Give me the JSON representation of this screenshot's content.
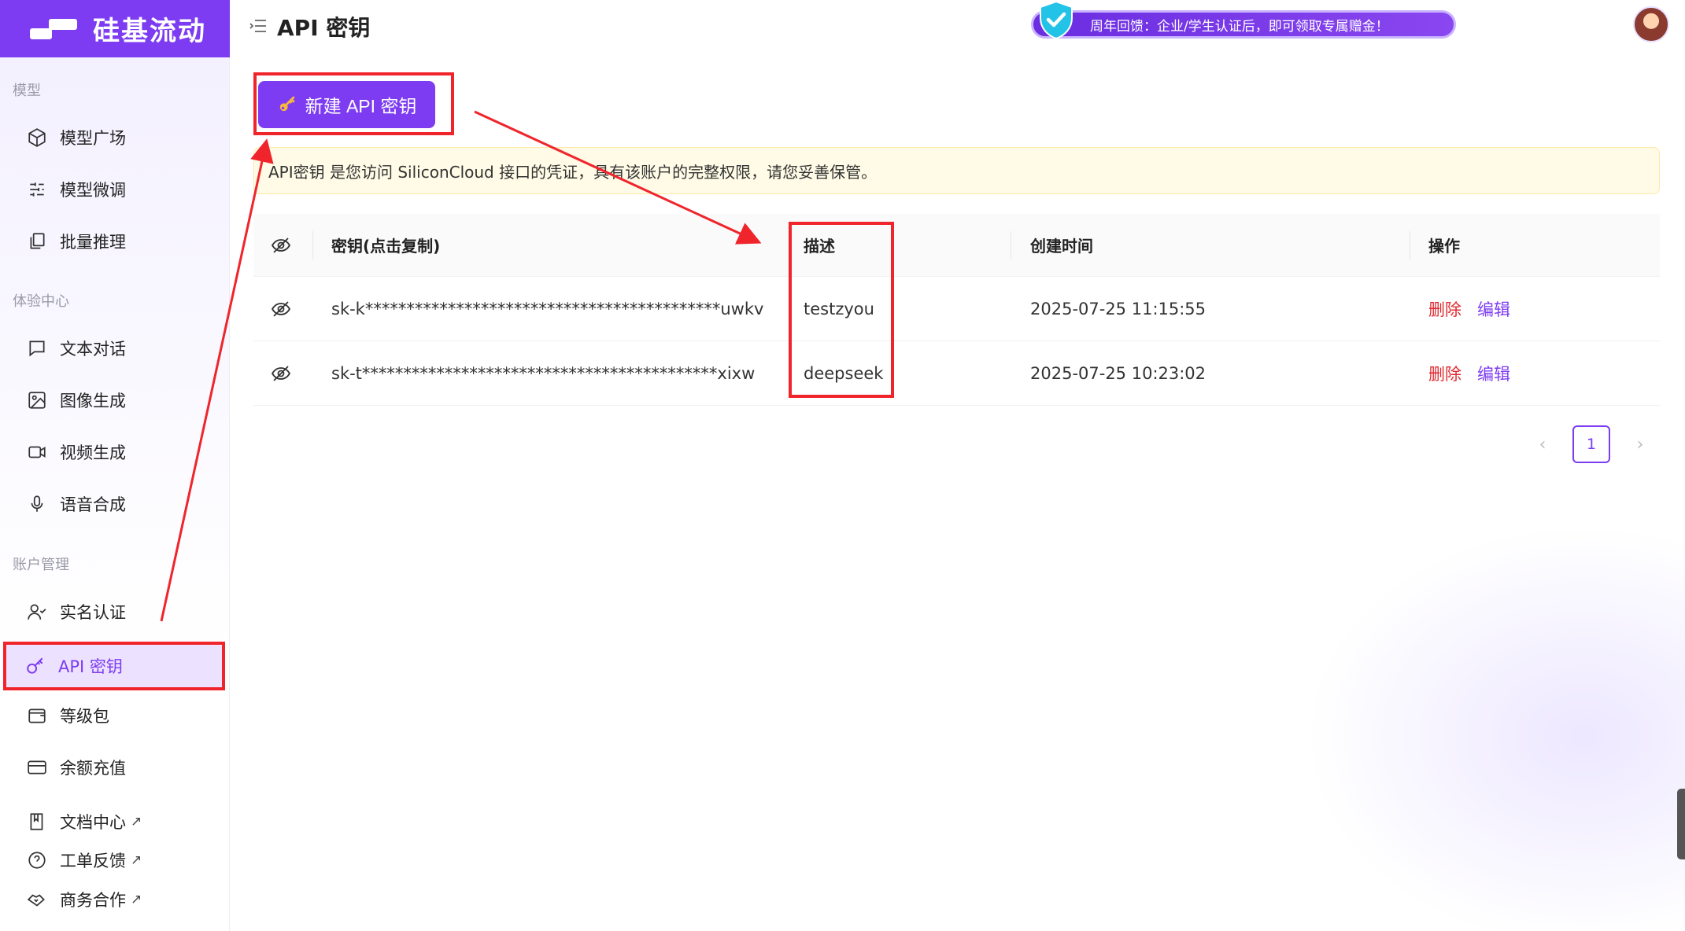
{
  "brand": {
    "name": "硅基流动",
    "color": "#7d3cf2"
  },
  "header": {
    "title": "API 密钥",
    "promo_text": "周年回馈：企业/学生认证后，即可领取专属赠金！"
  },
  "sidebar": {
    "sections": [
      {
        "label": "模型"
      },
      {
        "label": "体验中心"
      },
      {
        "label": "账户管理"
      }
    ],
    "items": [
      {
        "label": "模型广场",
        "icon": "cube-icon"
      },
      {
        "label": "模型微调",
        "icon": "sliders-icon"
      },
      {
        "label": "批量推理",
        "icon": "copy-stack-icon"
      },
      {
        "label": "文本对话",
        "icon": "chat-icon"
      },
      {
        "label": "图像生成",
        "icon": "image-icon"
      },
      {
        "label": "视频生成",
        "icon": "video-icon"
      },
      {
        "label": "语音合成",
        "icon": "mic-icon"
      },
      {
        "label": "实名认证",
        "icon": "user-check-icon"
      },
      {
        "label": "API 密钥",
        "icon": "key-icon",
        "active": true
      },
      {
        "label": "等级包",
        "icon": "wallet-icon"
      },
      {
        "label": "余额充值",
        "icon": "card-icon"
      },
      {
        "label": "文档中心",
        "icon": "book-icon",
        "external": "↗"
      },
      {
        "label": "工单反馈",
        "icon": "help-circle-icon",
        "external": "↗"
      },
      {
        "label": "商务合作",
        "icon": "handshake-icon",
        "external": "↗"
      }
    ]
  },
  "main": {
    "new_key_label": "新建 API 密钥",
    "notice": "API密钥 是您访问 SiliconCloud 接口的凭证，具有该账户的完整权限，请您妥善保管。",
    "table": {
      "headers": {
        "key": "密钥(点击复制)",
        "desc": "描述",
        "time": "创建时间",
        "action": "操作"
      },
      "rows": [
        {
          "key": "sk-k*******************************************uwkv",
          "desc": "testzyou",
          "time": "2025-07-25 11:15:55",
          "delete": "删除",
          "edit": "编辑"
        },
        {
          "key": "sk-t*******************************************xixw",
          "desc": "deepseek",
          "time": "2025-07-25 10:23:02",
          "delete": "删除",
          "edit": "编辑"
        }
      ]
    },
    "pagination": {
      "current": "1",
      "prev": "‹",
      "next": "›"
    }
  },
  "colors": {
    "annotation": "#f0252c",
    "danger": "#e0282e",
    "notice_bg": "#fffbe6"
  }
}
